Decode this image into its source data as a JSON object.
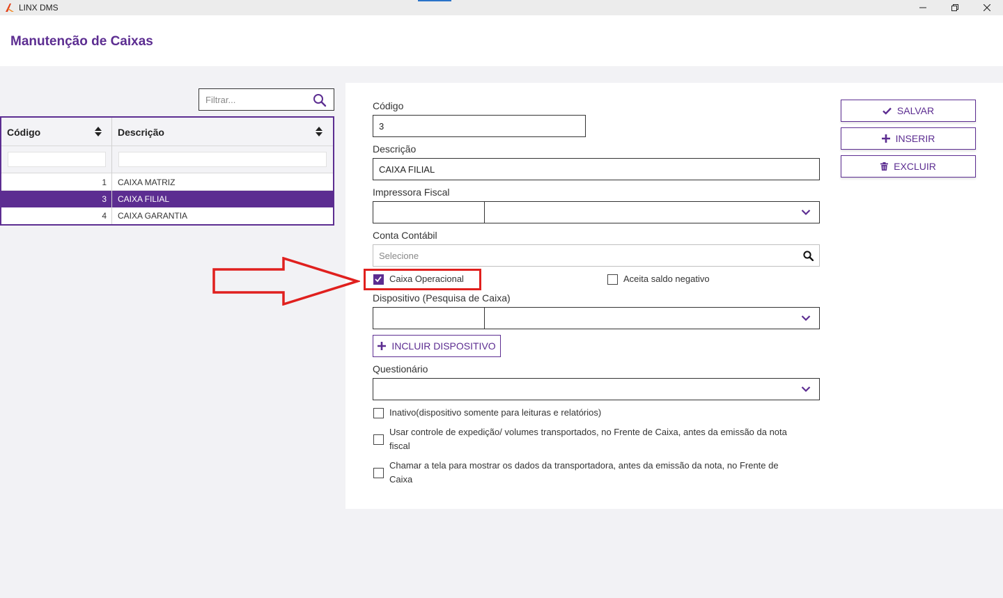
{
  "window": {
    "app_title": "LINX DMS",
    "controls": [
      "minimize-icon",
      "restore-icon",
      "close-icon"
    ]
  },
  "header": {
    "title": "Manutenção de Caixas"
  },
  "list": {
    "filter_placeholder": "Filtrar...",
    "columns": [
      "Código",
      "Descrição"
    ],
    "rows": [
      {
        "codigo": "1",
        "descricao": "CAIXA MATRIZ",
        "selected": false
      },
      {
        "codigo": "3",
        "descricao": "CAIXA FILIAL",
        "selected": true
      },
      {
        "codigo": "4",
        "descricao": "CAIXA GARANTIA",
        "selected": false
      }
    ]
  },
  "form": {
    "codigo_label": "Código",
    "codigo_value": "3",
    "descricao_label": "Descrição",
    "descricao_value": "CAIXA FILIAL",
    "impressora_label": "Impressora Fiscal",
    "conta_label": "Conta Contábil",
    "conta_placeholder": "Selecione",
    "caixa_operacional_label": "Caixa Operacional",
    "caixa_operacional_checked": true,
    "aceita_saldo_label": "Aceita saldo negativo",
    "aceita_saldo_checked": false,
    "dispositivo_label": "Dispositivo (Pesquisa de Caixa)",
    "incluir_dispositivo_label": "INCLUIR DISPOSITIVO",
    "questionario_label": "Questionário",
    "option_inativo": "Inativo(dispositivo somente para leituras e relatórios)",
    "option_expedicao_line1": "Usar controle de expedição/ volumes transportados, no Frente de Caixa, antes da emissão da nota",
    "option_expedicao_line2": "fiscal",
    "option_transportadora_line1": "Chamar a tela para mostrar os dados da transportadora, antes da emissão da nota, no Frente de",
    "option_transportadora_line2": "Caixa"
  },
  "actions": {
    "salvar": "SALVAR",
    "inserir": "INSERIR",
    "excluir": "EXCLUIR"
  },
  "colors": {
    "brand": "#5c2d91",
    "annotation": "#e0201e"
  }
}
